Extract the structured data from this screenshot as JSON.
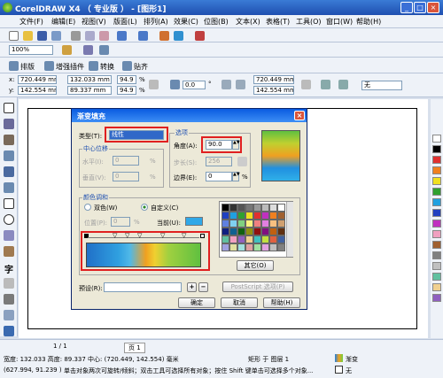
{
  "window": {
    "title": "CorelDRAW X4 （ 专业版 ） - [图形1]"
  },
  "menu": [
    "文件(F)",
    "编辑(E)",
    "视图(V)",
    "版面(L)",
    "排列(A)",
    "效果(C)",
    "位图(B)",
    "文本(X)",
    "表格(T)",
    "工具(O)",
    "窗口(W)",
    "帮助(H)"
  ],
  "toolbar": {
    "zoom": "100%"
  },
  "toolbar3": {
    "items": [
      "排版",
      "增强插件",
      "转换",
      "贴齐"
    ]
  },
  "property_bar": {
    "x": "720.449 mm",
    "y": "142.554 mm",
    "width": "132.033 mm",
    "height": "89.337 mm",
    "scale_x": "94.9",
    "scale_y": "94.9",
    "pct": "%",
    "angle": "0.0",
    "deg": "°",
    "pos_x": "720.449 mm",
    "pos_y": "142.554 mm",
    "outline": "无"
  },
  "dialog": {
    "title": "渐变填充",
    "type_label": "类型(T):",
    "type_value": "线性",
    "options_label": "选项",
    "angle_label": "角度(A):",
    "angle_value": "90.0",
    "steps_label": "步长(S):",
    "steps_value": "256",
    "edge_label": "边界(E):",
    "edge_value": "0",
    "pct": "%",
    "center_label": "中心位移",
    "h_label": "水平(I):",
    "h_value": "0",
    "v_label": "垂直(V):",
    "v_value": "0",
    "color_blend_label": "颜色调和",
    "two_color": "双色(W)",
    "custom": "自定义(C)",
    "position_label": "位置(P):",
    "position_value": "0",
    "current_label": "当前(U):",
    "other_button": "其它(O)",
    "preset_label": "预设(R):",
    "postscript_button": "PostScript 选项(P)",
    "ok": "确定",
    "cancel": "取消",
    "help": "帮助(H)"
  },
  "status": {
    "size": "宽度: 132.033 高度: 89.337 中心: (720.449, 142.554) 毫米",
    "object": "矩形 于 图层 1",
    "coords": "(627.994, 91.239 )",
    "hint": "单击对象两次可旋转/倾斜；双击工具可选择所有对象；按住 Shift 键单击可选择多个对象...",
    "fill": "渐变",
    "outline": "无",
    "page_nav": "1 / 1",
    "page_tab": "页 1"
  },
  "colors": {
    "accent": "#1f4fb0",
    "highlight": "#e02020"
  }
}
